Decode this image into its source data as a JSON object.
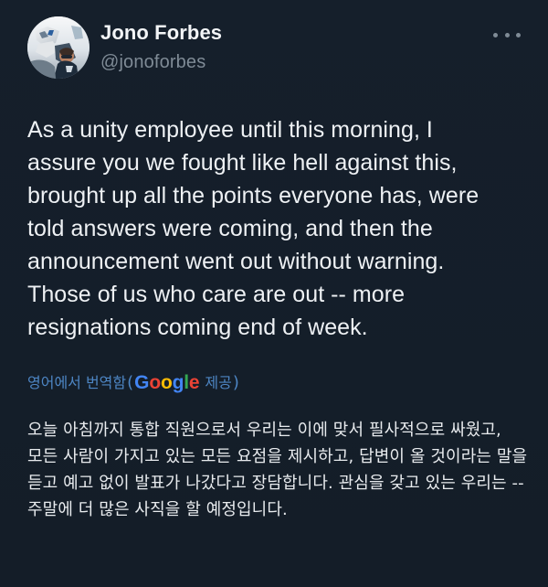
{
  "author": {
    "display_name": "Jono Forbes",
    "handle": "@jonoforbes",
    "avatar_icon": "profile-avatar-icon"
  },
  "actions": {
    "more_icon": "more-horizontal-icon"
  },
  "tweet": {
    "text": "As a unity employee until this morning, I\nassure you we fought like hell against this,\nbrought up all the points everyone has, were\ntold answers were coming, and then the\nannouncement went out without warning.\nThose of us who care are out -- more\nresignations coming end of week."
  },
  "translation": {
    "prefix": "영어에서 번역함",
    "open_paren": "(",
    "google_brand": "Google",
    "suffix": "제공",
    "close_paren": ")",
    "text": "오늘 아침까지 통합 직원으로서 우리는 이에 맞서 필사적으로 싸웠고, 모든 사람이 가지고 있는 모든 요점을 제시하고, 답변이 올 것이라는 말을 듣고 예고 없이 발표가 나갔다고 장담합니다. 관심을 갖고 있는 우리는 -- 주말에 더 많은 사직을 할 예정입니다."
  },
  "colors": {
    "background": "#15202b",
    "text": "#eef1f4",
    "secondary": "#7f8b96",
    "link": "#4d86c4",
    "google_blue": "#4285f4",
    "google_red": "#ea4335",
    "google_yellow": "#fbbc05",
    "google_green": "#34a853"
  }
}
